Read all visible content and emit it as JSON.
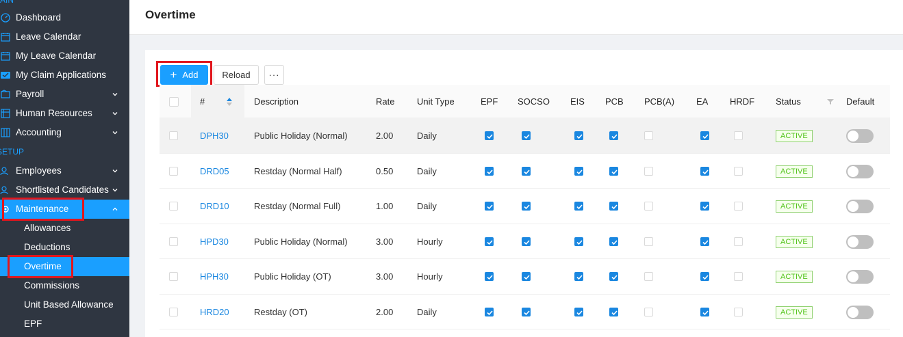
{
  "sidebar": {
    "section_top": "MAIN",
    "section_setup": "SETUP",
    "items": [
      {
        "label": "Dashboard",
        "icon": "dashboard-icon"
      },
      {
        "label": "Leave Calendar",
        "icon": "calendar-icon"
      },
      {
        "label": "My Leave Calendar",
        "icon": "calendar-icon"
      },
      {
        "label": "My Claim Applications",
        "icon": "claim-icon"
      },
      {
        "label": "Payroll",
        "icon": "payroll-icon"
      },
      {
        "label": "Human Resources",
        "icon": "human-resources-icon"
      },
      {
        "label": "Accounting",
        "icon": "accounting-icon"
      },
      {
        "label": "Employees",
        "icon": "employees-icon"
      },
      {
        "label": "Shortlisted Candidates",
        "icon": "candidates-icon"
      },
      {
        "label": "Maintenance",
        "icon": "maintenance-icon"
      }
    ],
    "sub_items": [
      {
        "label": "Allowances"
      },
      {
        "label": "Deductions"
      },
      {
        "label": "Overtime"
      },
      {
        "label": "Commissions"
      },
      {
        "label": "Unit Based Allowance"
      },
      {
        "label": "EPF"
      }
    ]
  },
  "page": {
    "title": "Overtime"
  },
  "toolbar": {
    "add_label": "Add",
    "reload_label": "Reload",
    "more_label": "···"
  },
  "table": {
    "headers": {
      "code": "#",
      "description": "Description",
      "rate": "Rate",
      "unit_type": "Unit Type",
      "epf": "EPF",
      "socso": "SOCSO",
      "eis": "EIS",
      "pcb": "PCB",
      "pcba": "PCB(A)",
      "ea": "EA",
      "hrdf": "HRDF",
      "status": "Status",
      "default": "Default"
    },
    "rows": [
      {
        "code": "DPH30",
        "description": "Public Holiday (Normal)",
        "rate": "2.00",
        "unit_type": "Daily",
        "status": "ACTIVE"
      },
      {
        "code": "DRD05",
        "description": "Restday (Normal Half)",
        "rate": "0.50",
        "unit_type": "Daily",
        "status": "ACTIVE"
      },
      {
        "code": "DRD10",
        "description": "Restday (Normal Full)",
        "rate": "1.00",
        "unit_type": "Daily",
        "status": "ACTIVE"
      },
      {
        "code": "HPD30",
        "description": "Public Holiday (Normal)",
        "rate": "3.00",
        "unit_type": "Hourly",
        "status": "ACTIVE"
      },
      {
        "code": "HPH30",
        "description": "Public Holiday (OT)",
        "rate": "3.00",
        "unit_type": "Hourly",
        "status": "ACTIVE"
      },
      {
        "code": "HRD20",
        "description": "Restday (OT)",
        "rate": "2.00",
        "unit_type": "Daily",
        "status": "ACTIVE"
      }
    ]
  },
  "colors": {
    "accent": "#1a9fff",
    "sidebar_bg": "#2f3641",
    "highlight": "#e1161d",
    "active_badge": "#52c41a"
  }
}
